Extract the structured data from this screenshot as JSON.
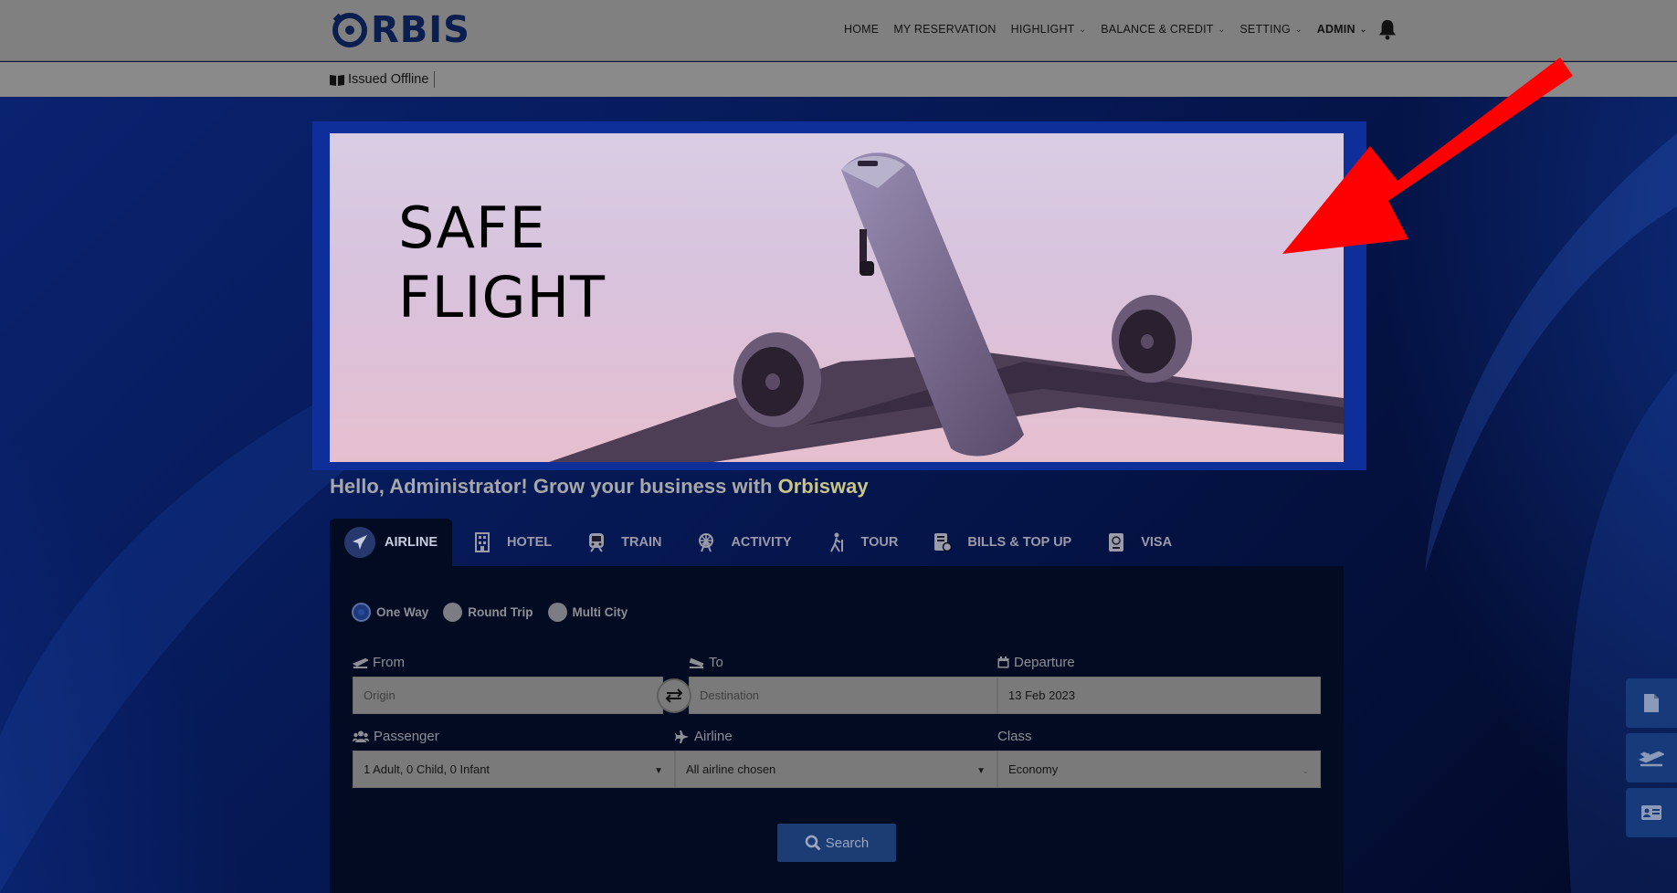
{
  "header": {
    "logo_text": "RBIS",
    "nav": [
      {
        "label": "HOME"
      },
      {
        "label": "MY RESERVATION"
      },
      {
        "label": "HIGHLIGHT"
      },
      {
        "label": "BALANCE & CREDIT"
      },
      {
        "label": "SETTING"
      },
      {
        "label": "ADMIN"
      }
    ],
    "icons": {
      "notifications": "bell-icon"
    }
  },
  "subbar": {
    "issued_label": "Issued Offline"
  },
  "banner": {
    "title": "SAFE\nFLIGHT"
  },
  "greeting": {
    "text": "Hello, Administrator! Grow your business with ",
    "brand": "Orbisway"
  },
  "tabs": [
    {
      "label": "AIRLINE",
      "icon": "airplane-icon",
      "active": true
    },
    {
      "label": "HOTEL",
      "icon": "hotel-icon"
    },
    {
      "label": "TRAIN",
      "icon": "train-icon"
    },
    {
      "label": "ACTIVITY",
      "icon": "ferris-wheel-icon"
    },
    {
      "label": "TOUR",
      "icon": "hiker-icon"
    },
    {
      "label": "BILLS & TOP UP",
      "icon": "bill-icon"
    },
    {
      "label": "VISA",
      "icon": "passport-icon"
    }
  ],
  "trip_type": {
    "options": [
      "One Way",
      "Round Trip",
      "Multi City"
    ],
    "selected": "One Way"
  },
  "form": {
    "from": {
      "label": "From",
      "placeholder": "Origin"
    },
    "to": {
      "label": "To",
      "placeholder": "Destination"
    },
    "departure": {
      "label": "Departure",
      "value": "13 Feb 2023"
    },
    "passenger": {
      "label": "Passenger",
      "value": "1 Adult, 0 Child, 0 Infant"
    },
    "airline": {
      "label": "Airline",
      "value": "All airline chosen"
    },
    "class": {
      "label": "Class",
      "value": "Economy"
    },
    "search_label": "Search"
  },
  "side_buttons": [
    "document-icon",
    "flight-departure-icon",
    "id-card-icon"
  ],
  "colors": {
    "annotation_arrow": "#ff0000",
    "brand_accent": "#c9c48a"
  }
}
